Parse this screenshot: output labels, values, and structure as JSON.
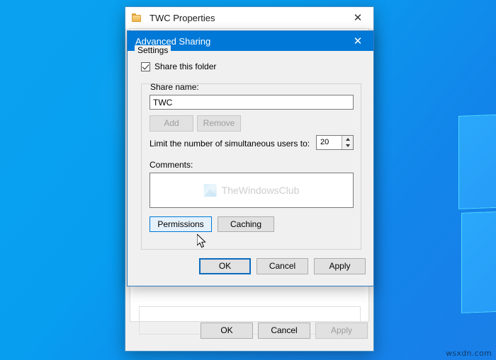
{
  "desktop": {
    "site_watermark": "wsxdn.com",
    "background_color": "#0a9ef0",
    "logo_pane_color": "#2aa8fb"
  },
  "properties_window": {
    "title": "TWC Properties",
    "icon": "folder-icon",
    "close_icon": "close-icon",
    "footer": {
      "ok_label": "OK",
      "cancel_label": "Cancel",
      "apply_label": "Apply",
      "apply_disabled": true
    }
  },
  "advanced_sharing": {
    "title": "Advanced Sharing",
    "close_icon": "close-icon",
    "title_bar_color": "#0078d7",
    "share_folder": {
      "label": "Share this folder",
      "checked": true
    },
    "settings_group": {
      "legend": "Settings",
      "share_name_label": "Share name:",
      "share_name_value": "TWC",
      "add_label": "Add",
      "add_disabled": true,
      "remove_label": "Remove",
      "remove_disabled": true,
      "limit_label": "Limit the number of simultaneous users to:",
      "limit_value": "20",
      "comments_label": "Comments:",
      "comments_value": "",
      "watermark_text": "TheWindowsClub",
      "permissions_label": "Permissions",
      "caching_label": "Caching"
    },
    "footer": {
      "ok_label": "OK",
      "cancel_label": "Cancel",
      "apply_label": "Apply"
    }
  }
}
